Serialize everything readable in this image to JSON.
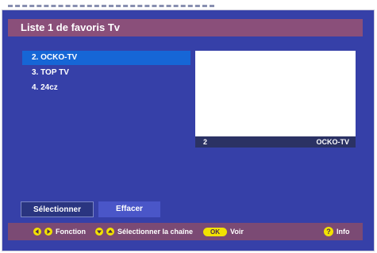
{
  "header": {
    "title": "Liste 1 de favoris Tv"
  },
  "channels": [
    {
      "label": "2. OCKO-TV",
      "selected": true
    },
    {
      "label": "3. TOP TV",
      "selected": false
    },
    {
      "label": "4. 24cz",
      "selected": false
    }
  ],
  "preview": {
    "number": "2",
    "name": "OCKO-TV"
  },
  "buttons": {
    "select": "Sélectionner",
    "erase": "Effacer"
  },
  "footer": {
    "function_label": "Fonction",
    "select_channel_label": "Sélectionner la chaîne",
    "ok_key": "OK",
    "view_label": "Voir",
    "info_key": "?",
    "info_label": "Info"
  },
  "colors": {
    "background": "#3640a8",
    "title_bar": "#8a4f7a",
    "selected_item": "#1666d6",
    "key_yellow": "#f2e200"
  }
}
